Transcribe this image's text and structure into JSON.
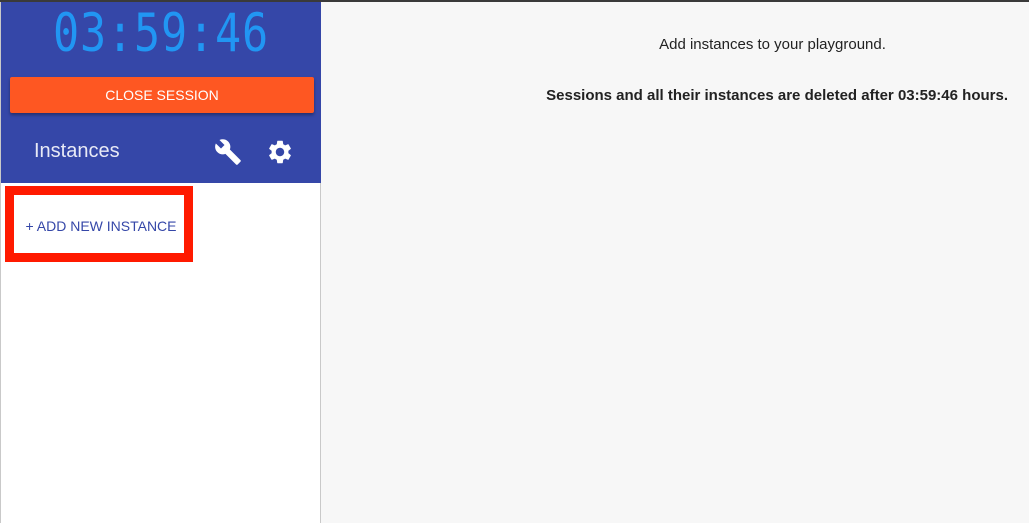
{
  "session": {
    "timer": "03:59:46",
    "close_label": "CLOSE SESSION"
  },
  "sidebar": {
    "title": "Instances",
    "tools_icon": "wrench-icon",
    "settings_icon": "gear-icon",
    "add_instance_label": "+ ADD NEW INSTANCE"
  },
  "main": {
    "prompt": "Add instances to your playground.",
    "notice_prefix": "Sessions and all their instances are deleted after ",
    "notice_time": "03:59:46",
    "notice_suffix": " hours."
  },
  "colors": {
    "sidebar_header": "#3547a8",
    "timer": "#2196f3",
    "close_button": "#fe5722",
    "highlight": "#ff1a00",
    "main_bg": "#f7f7f7"
  }
}
